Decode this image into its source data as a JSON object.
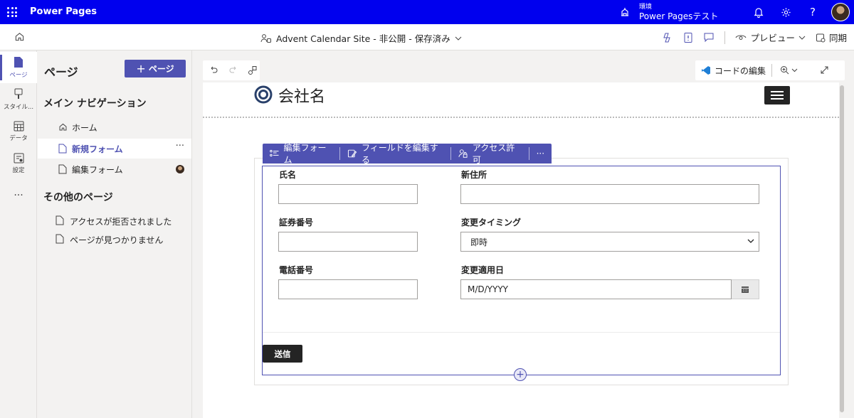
{
  "topbar": {
    "app_title": "Power Pages",
    "env_label": "環境",
    "env_name": "Power Pagesテスト"
  },
  "cmdbar": {
    "site_status": "Advent Calendar Site - 非公開 - 保存済み",
    "preview_label": "プレビュー",
    "sync_label": "同期"
  },
  "rail": {
    "items": [
      {
        "label": "ページ",
        "icon": "page-icon"
      },
      {
        "label": "スタイル...",
        "icon": "brush-icon"
      },
      {
        "label": "データ",
        "icon": "table-icon"
      },
      {
        "label": "設定",
        "icon": "settings-icon"
      },
      {
        "label": "...",
        "icon": "more-icon"
      }
    ]
  },
  "panel": {
    "title": "ページ",
    "add_page_label": "ページ",
    "main_nav_header": "メイン ナビゲーション",
    "main_nav": [
      {
        "label": "ホーム",
        "icon": "home-icon"
      },
      {
        "label": "新規フォーム",
        "icon": "page-icon",
        "more": "···"
      },
      {
        "label": "編集フォーム",
        "icon": "page-icon"
      }
    ],
    "other_header": "その他のページ",
    "other_pages": [
      {
        "label": "アクセスが拒否されました"
      },
      {
        "label": "ページが見つかりません"
      }
    ]
  },
  "codebar": {
    "edit_code_label": "コードの編集"
  },
  "site": {
    "company_name": "会社名"
  },
  "form_toolbar": {
    "edit_form": "編集フォーム",
    "edit_fields": "フィールドを編集する",
    "permissions": "アクセス許可",
    "more": "···"
  },
  "form": {
    "fields": {
      "name_label": "氏名",
      "new_address_label": "新住所",
      "id_number_label": "証券番号",
      "timing_label": "変更タイミング",
      "timing_value": "即時",
      "phone_label": "電話番号",
      "effective_date_label": "変更適用日",
      "effective_date_placeholder": "M/D/YYYY"
    },
    "submit_label": "送信"
  },
  "colors": {
    "topbar": "#0000ee",
    "accent": "#4f52b2",
    "dark_button": "#242424"
  }
}
